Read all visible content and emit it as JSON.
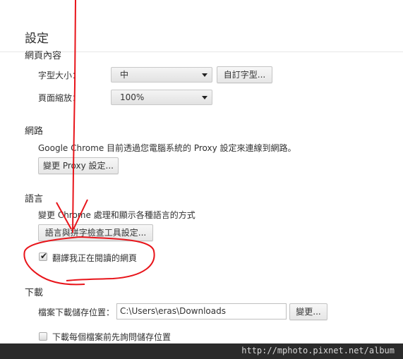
{
  "page": {
    "title": "設定"
  },
  "web_content": {
    "section_title": "網頁內容",
    "font_size": {
      "label": "字型大小：",
      "value": "中",
      "custom_button": "自訂字型..."
    },
    "page_zoom": {
      "label": "頁面縮放：",
      "value": "100%"
    }
  },
  "network": {
    "section_title": "網路",
    "description": "Google Chrome 目前透過您電腦系統的 Proxy 設定來連線到網路。",
    "change_proxy_button": "變更 Proxy 設定..."
  },
  "languages": {
    "section_title": "語言",
    "description": "變更 Chrome 處理和顯示各種語言的方式",
    "settings_button": "語言與拼字檢查工具設定...",
    "translate_checkbox": {
      "label": "翻譯我正在閱讀的網頁",
      "checked": true
    }
  },
  "downloads": {
    "section_title": "下載",
    "location_label": "檔案下載儲存位置：",
    "location_value": "C:\\Users\\eras\\Downloads",
    "change_button": "變更...",
    "ask_checkbox": {
      "label": "下載每個檔案前先詢問儲存位置",
      "checked": false
    }
  },
  "watermark": {
    "text": "http://mphoto.pixnet.net/album"
  },
  "annotation": {
    "color": "#e8141a"
  }
}
